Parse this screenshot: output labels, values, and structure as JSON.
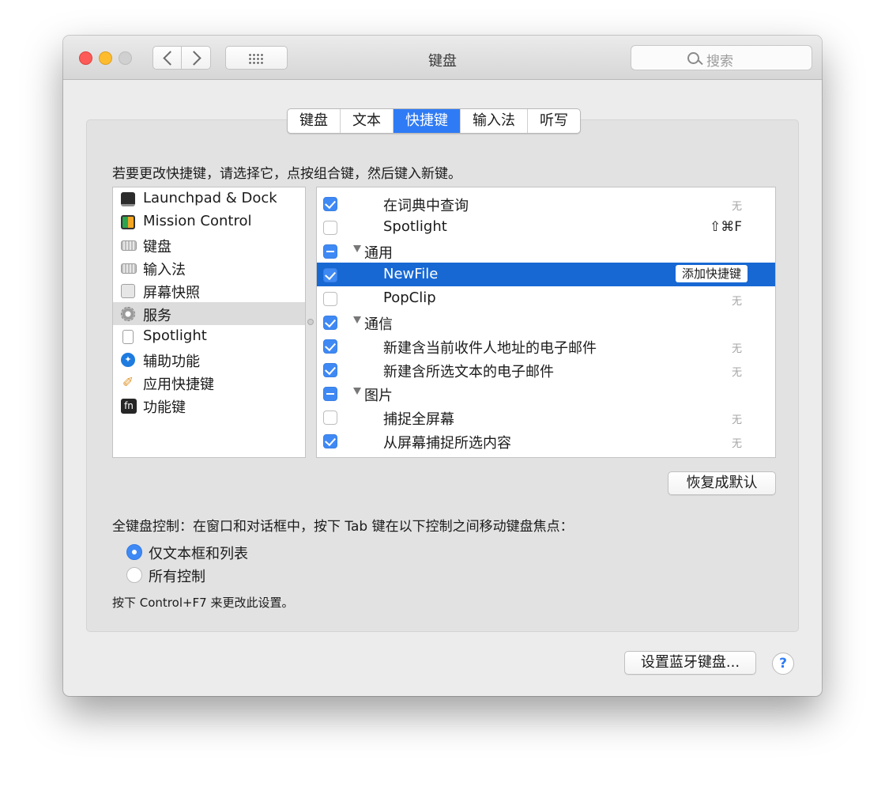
{
  "window": {
    "title": "键盘",
    "search_placeholder": "搜索"
  },
  "tabs": [
    {
      "label": "键盘",
      "active": false
    },
    {
      "label": "文本",
      "active": false
    },
    {
      "label": "快捷键",
      "active": true
    },
    {
      "label": "输入法",
      "active": false
    },
    {
      "label": "听写",
      "active": false
    }
  ],
  "instruction": "若要更改快捷键，请选择它，点按组合键，然后键入新键。",
  "categories": [
    {
      "label": "Launchpad & Dock",
      "icon": "launchpad-dock-icon",
      "selected": false
    },
    {
      "label": "Mission Control",
      "icon": "mission-control-icon",
      "selected": false
    },
    {
      "label": "键盘",
      "icon": "keyboard-icon",
      "selected": false
    },
    {
      "label": "输入法",
      "icon": "input-method-icon",
      "selected": false
    },
    {
      "label": "屏幕快照",
      "icon": "screenshot-icon",
      "selected": false
    },
    {
      "label": "服务",
      "icon": "services-gear-icon",
      "selected": true
    },
    {
      "label": "Spotlight",
      "icon": "spotlight-icon",
      "selected": false
    },
    {
      "label": "辅助功能",
      "icon": "accessibility-icon",
      "selected": false
    },
    {
      "label": "应用快捷键",
      "icon": "app-shortcuts-icon",
      "selected": false
    },
    {
      "label": "功能键",
      "icon": "function-keys-icon",
      "selected": false
    }
  ],
  "icon_text": {
    "fn": "fn"
  },
  "shortcuts": [
    {
      "label": "在词典中查询",
      "state": "on",
      "group": false,
      "shortcut": "无",
      "selected": false
    },
    {
      "label": "Spotlight",
      "state": "off",
      "group": false,
      "shortcut": "⇧⌘F",
      "selected": false
    },
    {
      "label": "通用",
      "state": "mixed",
      "group": true,
      "shortcut": "",
      "selected": false
    },
    {
      "label": "NewFile",
      "state": "on",
      "group": false,
      "shortcut": "",
      "selected": true,
      "add_label": "添加快捷键"
    },
    {
      "label": "PopClip",
      "state": "off",
      "group": false,
      "shortcut": "无",
      "selected": false
    },
    {
      "label": "通信",
      "state": "on",
      "group": true,
      "shortcut": "",
      "selected": false
    },
    {
      "label": "新建含当前收件人地址的电子邮件",
      "state": "on",
      "group": false,
      "shortcut": "无",
      "selected": false
    },
    {
      "label": "新建含所选文本的电子邮件",
      "state": "on",
      "group": false,
      "shortcut": "无",
      "selected": false
    },
    {
      "label": "图片",
      "state": "mixed",
      "group": true,
      "shortcut": "",
      "selected": false
    },
    {
      "label": "捕捉全屏幕",
      "state": "off",
      "group": false,
      "shortcut": "无",
      "selected": false
    },
    {
      "label": "从屏幕捕捉所选内容",
      "state": "on",
      "group": false,
      "shortcut": "无",
      "selected": false
    }
  ],
  "restore_button": "恢复成默认",
  "full_keyboard": {
    "label": "全键盘控制：在窗口和对话框中，按下 Tab 键在以下控制之间移动键盘焦点：",
    "options": [
      {
        "label": "仅文本框和列表",
        "selected": true
      },
      {
        "label": "所有控制",
        "selected": false
      }
    ],
    "note": "按下 Control+F7 来更改此设置。"
  },
  "bluetooth_button": "设置蓝牙键盘...",
  "help_label": "?",
  "colors": {
    "accent": "#2f7bf5",
    "selection": "#1868d3",
    "checkbox": "#3f89f5"
  }
}
